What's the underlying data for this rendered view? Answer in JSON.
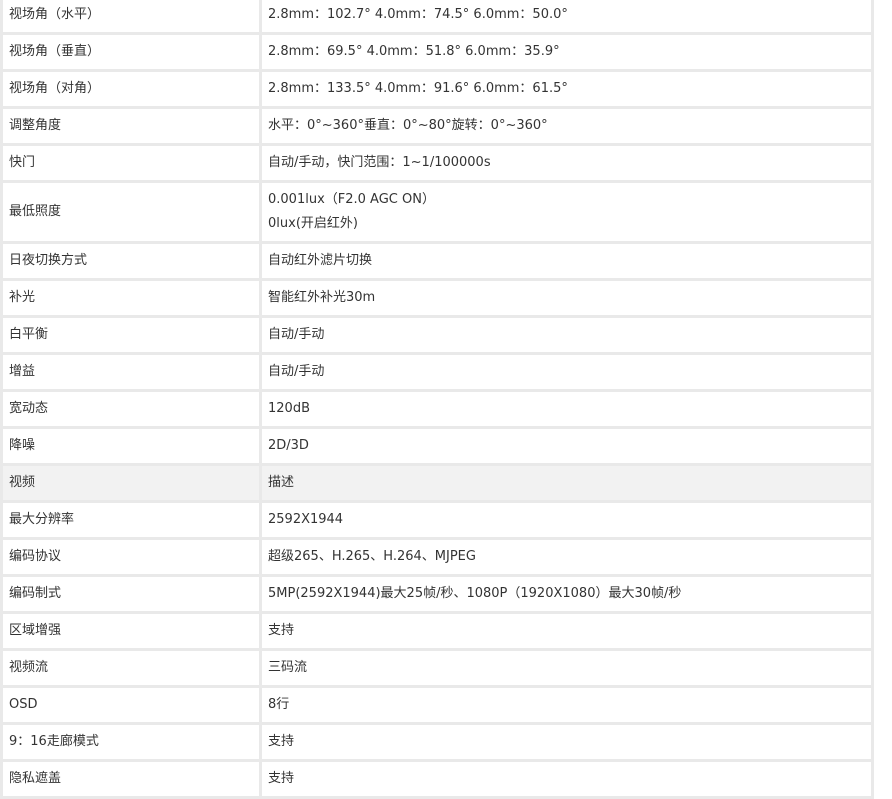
{
  "rows": [
    {
      "label": "视场角（水平）",
      "value": "2.8mm：102.7°    4.0mm：74.5°    6.0mm：50.0°"
    },
    {
      "label": "视场角（垂直）",
      "value": "2.8mm：69.5°     4.0mm：51.8°    6.0mm：35.9°"
    },
    {
      "label": "视场角（对角）",
      "value": "2.8mm：133.5°    4.0mm：91.6°    6.0mm：61.5°"
    },
    {
      "label": "调整角度",
      "value": "水平：0°~360°垂直：0°~80°旋转：0°~360°"
    },
    {
      "label": "快门",
      "value": "自动/手动，快门范围：1~1/100000s"
    },
    {
      "label": "最低照度",
      "value": "0.001lux（F2.0 AGC ON）",
      "value2": "0lux(开启红外)"
    },
    {
      "label": "日夜切换方式",
      "value": "自动红外滤片切换"
    },
    {
      "label": "补光",
      "value": "智能红外补光30m"
    },
    {
      "label": "白平衡",
      "value": "自动/手动"
    },
    {
      "label": "增益",
      "value": "自动/手动"
    },
    {
      "label": "宽动态",
      "value": "120dB"
    },
    {
      "label": "降噪",
      "value": "2D/3D"
    },
    {
      "label": "视频",
      "value": "描述"
    },
    {
      "label": "最大分辨率",
      "value": "2592X1944"
    },
    {
      "label": "编码协议",
      "value": "超级265、H.265、H.264、MJPEG"
    },
    {
      "label": "编码制式",
      "value": "5MP(2592X1944)最大25帧/秒、1080P（1920X1080）最大30帧/秒"
    },
    {
      "label": "区域增强",
      "value": "支持"
    },
    {
      "label": "视频流",
      "value": "三码流"
    },
    {
      "label": "OSD",
      "value": "8行"
    },
    {
      "label": "9：16走廊模式",
      "value": "支持"
    },
    {
      "label": "隐私遮盖",
      "value": "支持"
    }
  ]
}
